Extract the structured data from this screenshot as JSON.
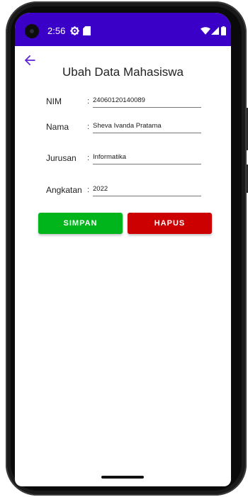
{
  "statusbar": {
    "time": "2:56"
  },
  "page": {
    "title": "Ubah Data Mahasiswa"
  },
  "form": {
    "nim": {
      "label": "NIM",
      "colon": ":",
      "value": "24060120140089"
    },
    "nama": {
      "label": "Nama",
      "colon": ":",
      "value": "Sheva Ivanda Pratama"
    },
    "jurusan": {
      "label": "Jurusan",
      "colon": ":",
      "value": "Informatika"
    },
    "angkatan": {
      "label": "Angkatan",
      "colon": ":",
      "value": "2022"
    }
  },
  "actions": {
    "save_label": "SIMPAN",
    "delete_label": "HAPUS"
  },
  "colors": {
    "statusbar": "#3a00c8",
    "accent": "#5b21d6",
    "save_button": "#00b51c",
    "delete_button": "#cc0000"
  },
  "icons": {
    "status_left": [
      "settings-icon",
      "sd-card-icon"
    ],
    "status_right": [
      "wifi-icon",
      "signal-icon",
      "battery-icon"
    ],
    "nav": "back-arrow-icon"
  }
}
